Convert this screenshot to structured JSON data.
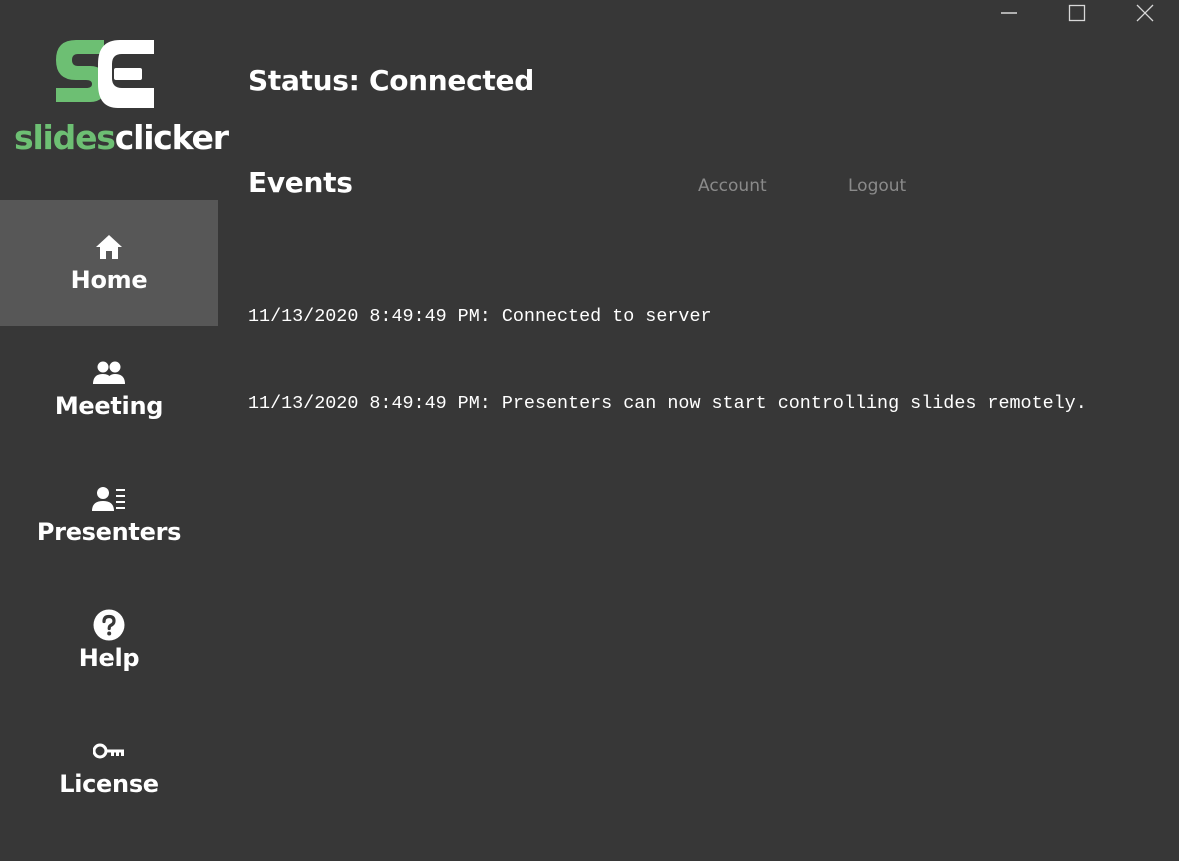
{
  "brand": {
    "logo_text_part1": "slides",
    "logo_text_part2": "clicker",
    "accent_color": "#6dbf73"
  },
  "window_controls": {
    "minimize": "minimize-icon",
    "maximize": "maximize-icon",
    "close": "close-icon"
  },
  "sidebar": {
    "items": [
      {
        "label": "Home",
        "icon": "home-icon",
        "active": true
      },
      {
        "label": "Meeting",
        "icon": "people-icon",
        "active": false
      },
      {
        "label": "Presenters",
        "icon": "presenter-list-icon",
        "active": false
      },
      {
        "label": "Help",
        "icon": "help-icon",
        "active": false
      },
      {
        "label": "License",
        "icon": "key-icon",
        "active": false
      }
    ]
  },
  "main": {
    "status": "Status: Connected",
    "events_title": "Events",
    "links": {
      "account": "Account",
      "logout": "Logout"
    },
    "events": [
      "11/13/2020 8:49:49 PM: Connected to server",
      "11/13/2020 8:49:49 PM: Presenters can now start controlling slides remotely."
    ]
  },
  "colors": {
    "background": "#373737",
    "active_item": "#575757",
    "link": "#8a8a8a"
  }
}
